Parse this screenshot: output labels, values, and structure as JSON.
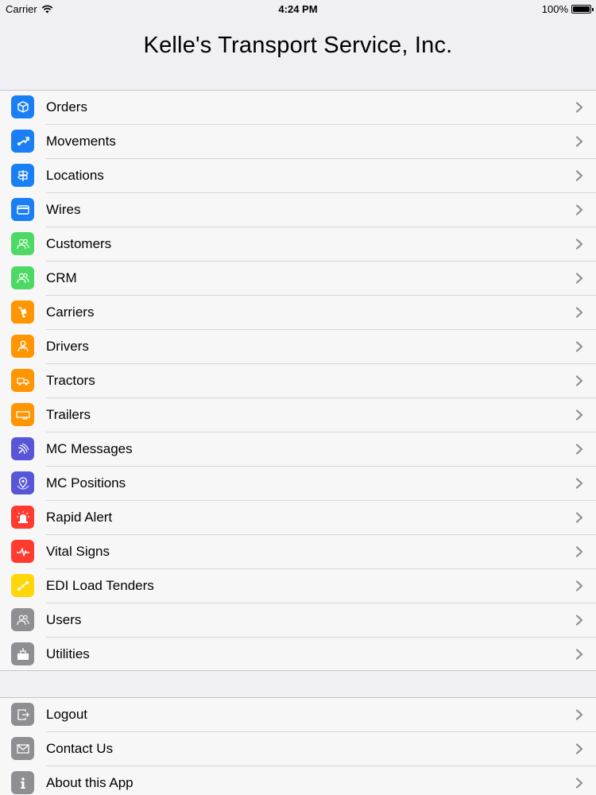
{
  "status_bar": {
    "carrier": "Carrier",
    "time": "4:24 PM",
    "battery": "100%"
  },
  "header": {
    "title": "Kelle's Transport Service, Inc."
  },
  "colors": {
    "blue": "#1a7ff5",
    "green": "#4cd964",
    "orange": "#ff9500",
    "purple": "#5856d6",
    "red": "#ff2d55",
    "yellow": "#ffd60a",
    "gray": "#8e8e93"
  },
  "menu": {
    "items": [
      {
        "label": "Orders",
        "icon": "box-icon",
        "color": "#1a7ff5"
      },
      {
        "label": "Movements",
        "icon": "route-icon",
        "color": "#1a7ff5"
      },
      {
        "label": "Locations",
        "icon": "signpost-icon",
        "color": "#1a7ff5"
      },
      {
        "label": "Wires",
        "icon": "card-icon",
        "color": "#1a7ff5"
      },
      {
        "label": "Customers",
        "icon": "people-icon",
        "color": "#4cd964"
      },
      {
        "label": "CRM",
        "icon": "people-icon",
        "color": "#4cd964"
      },
      {
        "label": "Carriers",
        "icon": "hand-truck-icon",
        "color": "#ff9500"
      },
      {
        "label": "Drivers",
        "icon": "driver-icon",
        "color": "#ff9500"
      },
      {
        "label": "Tractors",
        "icon": "tractor-icon",
        "color": "#ff9500"
      },
      {
        "label": "Trailers",
        "icon": "trailer-icon",
        "color": "#ff9500"
      },
      {
        "label": "MC Messages",
        "icon": "satellite-icon",
        "color": "#5856d6"
      },
      {
        "label": "MC Positions",
        "icon": "map-pin-icon",
        "color": "#5856d6"
      },
      {
        "label": "Rapid Alert",
        "icon": "siren-icon",
        "color": "#ff3b30"
      },
      {
        "label": "Vital Signs",
        "icon": "pulse-icon",
        "color": "#ff3b30"
      },
      {
        "label": "EDI Load Tenders",
        "icon": "link-nodes-icon",
        "color": "#ffd60a"
      },
      {
        "label": "Users",
        "icon": "people-icon",
        "color": "#8e8e93"
      },
      {
        "label": "Utilities",
        "icon": "toolbox-icon",
        "color": "#8e8e93"
      }
    ]
  },
  "secondary": {
    "items": [
      {
        "label": "Logout",
        "icon": "logout-icon",
        "color": "#8e8e93"
      },
      {
        "label": "Contact Us",
        "icon": "envelope-icon",
        "color": "#8e8e93"
      },
      {
        "label": "About this App",
        "icon": "info-icon",
        "color": "#8e8e93"
      }
    ]
  }
}
